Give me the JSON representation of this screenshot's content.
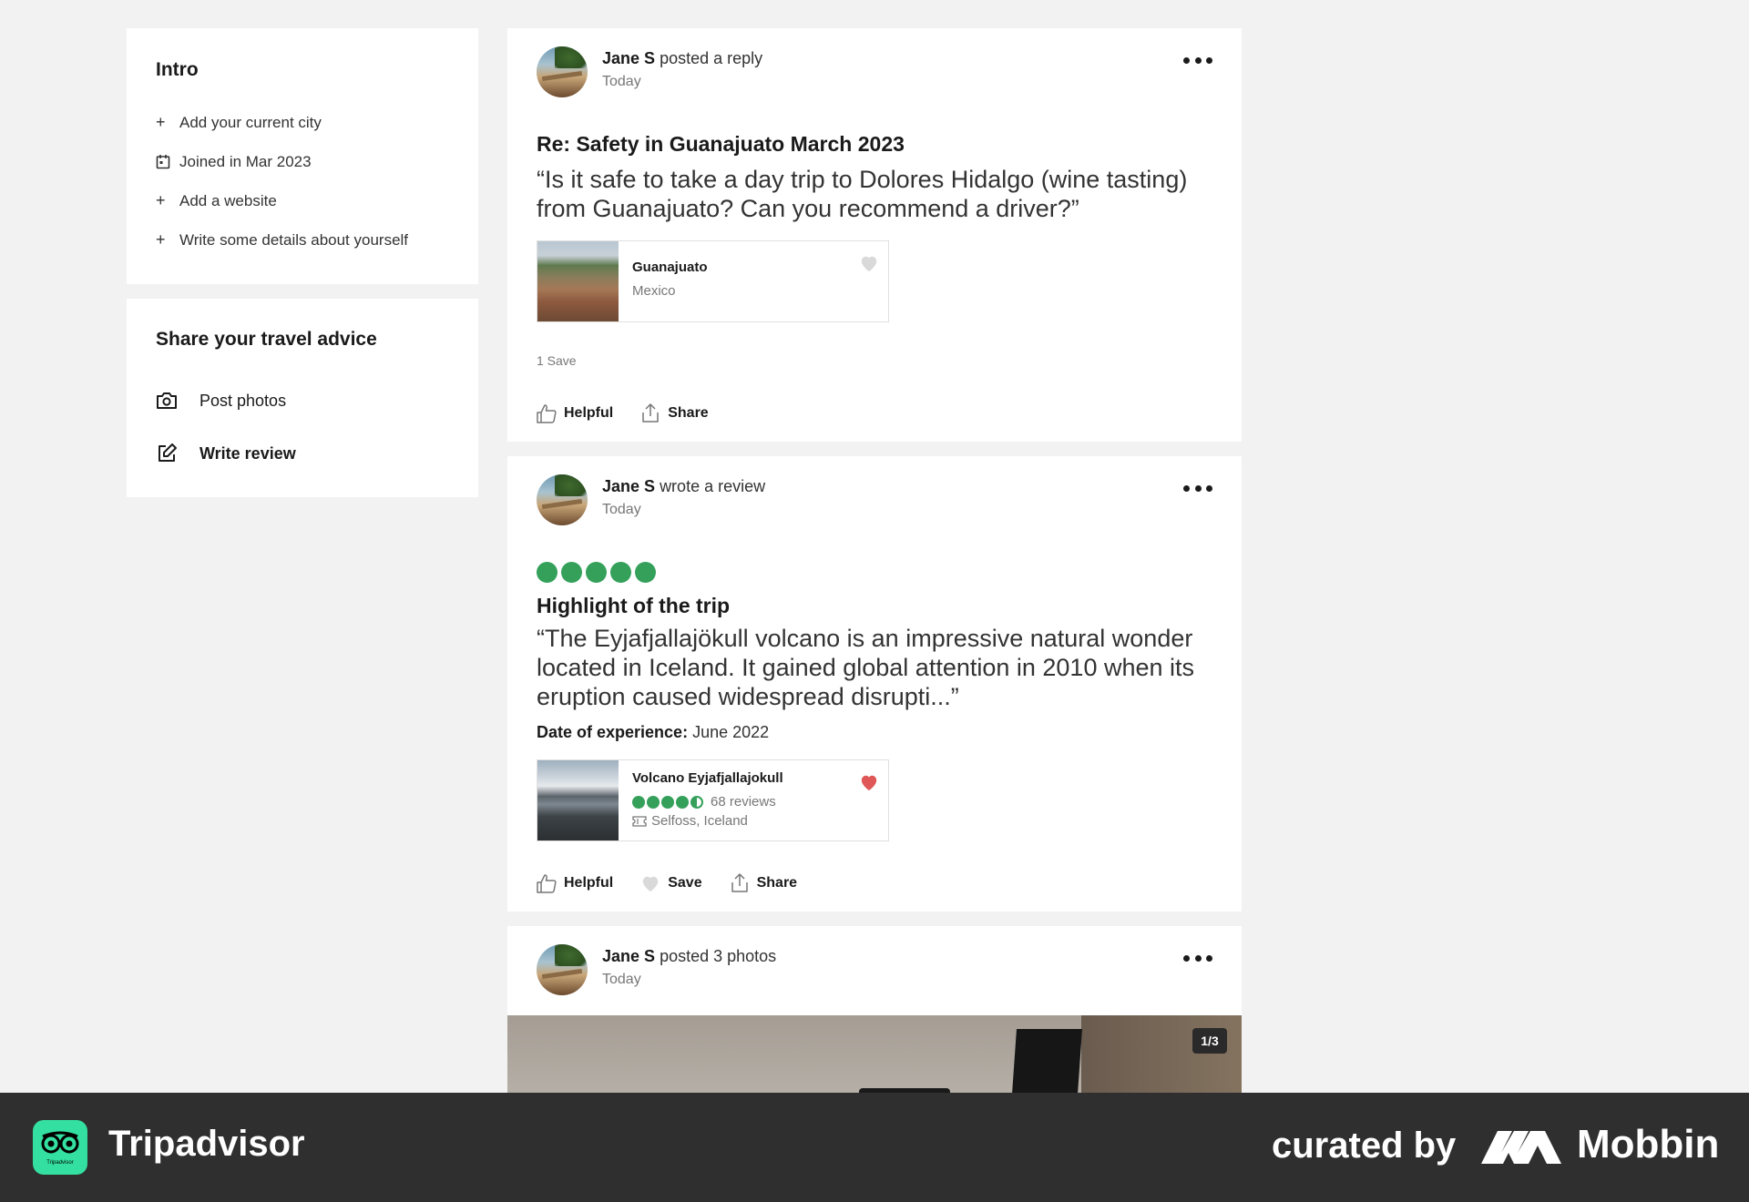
{
  "intro": {
    "title": "Intro",
    "items": [
      {
        "icon": "plus-icon",
        "label": "Add your current city"
      },
      {
        "icon": "calendar-icon",
        "label": "Joined in Mar 2023"
      },
      {
        "icon": "plus-icon",
        "label": "Add a website"
      },
      {
        "icon": "plus-icon",
        "label": "Write some details about yourself"
      }
    ]
  },
  "share_advice": {
    "title": "Share your travel advice",
    "post_photos": "Post photos",
    "write_review": "Write review"
  },
  "posts": [
    {
      "author": "Jane S",
      "action": "posted a reply",
      "time": "Today",
      "title": "Re: Safety in Guanajuato March 2023",
      "quote": "“Is it safe to take a day trip to Dolores Hidalgo (wine tasting) from Guanajuato? Can you recommend a driver?”",
      "place": {
        "name": "Guanajuato",
        "sub": "Mexico",
        "saved": false
      },
      "save_count": "1 Save",
      "helpful": "Helpful",
      "share": "Share"
    },
    {
      "author": "Jane S",
      "action": "wrote a review",
      "time": "Today",
      "rating": 5,
      "title": "Highlight of the trip",
      "quote": "“The Eyjafjallajökull volcano is an impressive natural wonder located in Iceland. It gained global attention in 2010 when its eruption caused widespread disrupti...”",
      "doe_label": "Date of experience:",
      "doe_value": "June 2022",
      "place": {
        "name": "Volcano Eyjafjallajokull",
        "rating": 4.5,
        "reviews": "68 reviews",
        "location": "Selfoss, Iceland",
        "saved": true
      },
      "helpful": "Helpful",
      "save": "Save",
      "share": "Share"
    },
    {
      "author": "Jane S",
      "action": "posted 3 photos",
      "time": "Today",
      "photo_counter": "1/3"
    }
  ],
  "colors": {
    "bubble_green": "#34a05a",
    "heart_red": "#e05757",
    "brand_green": "#34e0a1"
  },
  "banner": {
    "app_name": "Tripadvisor",
    "app_logo_text": "Tripadvisor",
    "curated_by": "curated by",
    "mobbin": "Mobbin"
  }
}
